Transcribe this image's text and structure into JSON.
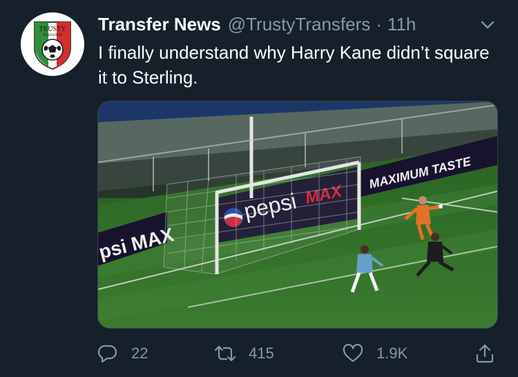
{
  "account": {
    "display_name": "Transfer News",
    "handle": "@TrustyTransfers",
    "separator": "·",
    "time": "11h",
    "avatar_text_top": "TRUSTY",
    "avatar_text_sub": "TRANSFERS"
  },
  "tweet": {
    "text": "I finally understand why Harry Kane didn’t square it to Sterling."
  },
  "media": {
    "board_left": "psi MAX",
    "board_center_word": "pepsi",
    "board_center_max": "MAX",
    "board_right": "MAXIMUM TASTE",
    "colors": {
      "pitch": "#3a7a2e",
      "keeper_kit": "#f07a2a",
      "attacker_kit": "#6fa7d6",
      "defender_kit": "#1e1e24",
      "board_bg": "#1a1430",
      "max_red": "#e0243c"
    }
  },
  "actions": {
    "reply": {
      "icon": "reply-icon",
      "count": "22"
    },
    "retweet": {
      "icon": "retweet-icon",
      "count": "415"
    },
    "like": {
      "icon": "heart-icon",
      "count": "1.9K"
    },
    "share": {
      "icon": "share-icon"
    }
  },
  "theme": {
    "background": "#15202b",
    "secondary_text": "#8899a6",
    "border": "#38444d"
  }
}
